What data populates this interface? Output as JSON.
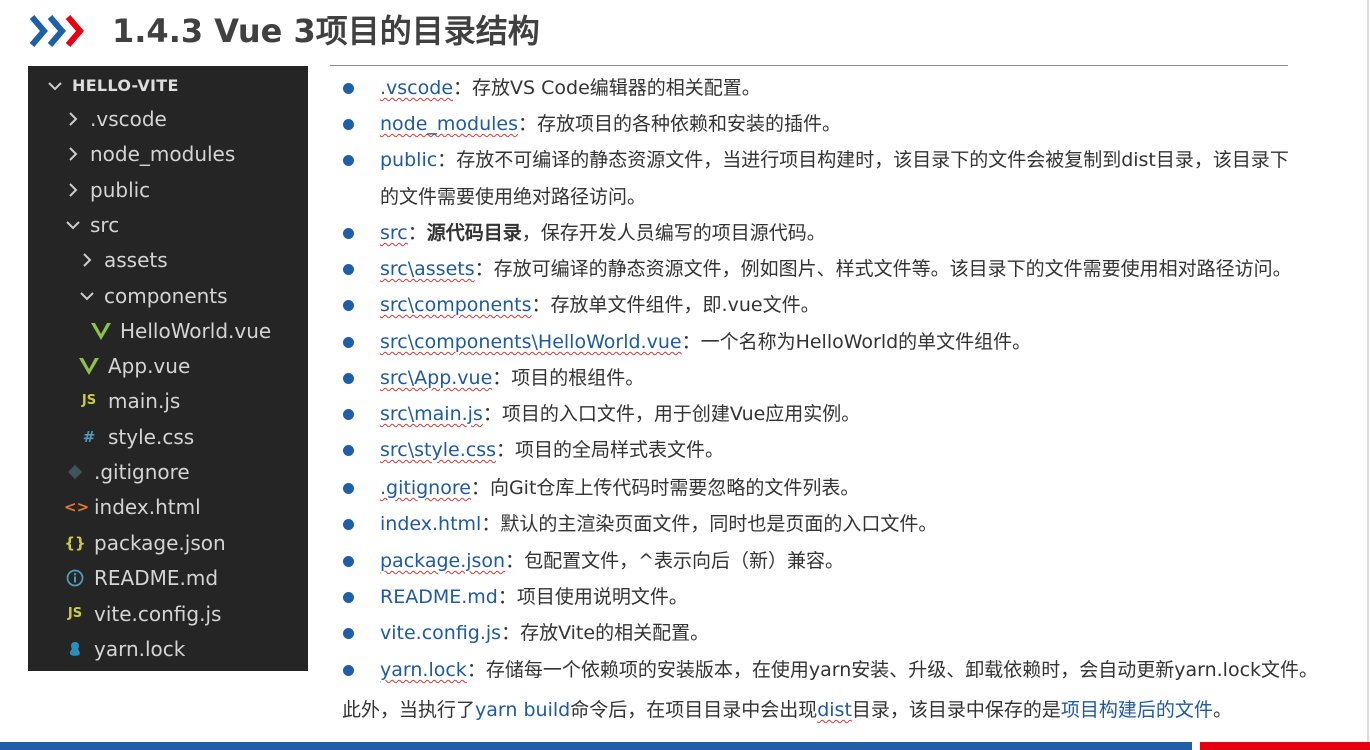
{
  "header": {
    "title": "1.4.3  Vue 3项目的目录结构"
  },
  "colors": {
    "accent_blue": "#1f5fa8",
    "accent_red": "#e60012",
    "explorer_bg": "#252526",
    "vue_green": "#8dc149",
    "js_yellow": "#cbcb41"
  },
  "explorer": {
    "root": "HELLO-VITE",
    "items": [
      {
        "label": ".vscode",
        "icon": "chevron-right-icon"
      },
      {
        "label": "node_modules",
        "icon": "chevron-right-icon"
      },
      {
        "label": "public",
        "icon": "chevron-right-icon"
      },
      {
        "label": "src",
        "icon": "chevron-down-icon"
      },
      {
        "label": "assets",
        "icon": "chevron-right-icon"
      },
      {
        "label": "components",
        "icon": "chevron-down-icon"
      },
      {
        "label": "HelloWorld.vue",
        "icon": "vue-icon"
      },
      {
        "label": "App.vue",
        "icon": "vue-icon"
      },
      {
        "label": "main.js",
        "icon": "js-icon",
        "icon_text": "JS"
      },
      {
        "label": "style.css",
        "icon": "css-icon",
        "icon_text": "#"
      },
      {
        "label": ".gitignore",
        "icon": "git-icon"
      },
      {
        "label": "index.html",
        "icon": "html-icon",
        "icon_text": "<>"
      },
      {
        "label": "package.json",
        "icon": "json-icon",
        "icon_text": "{}"
      },
      {
        "label": "README.md",
        "icon": "info-icon"
      },
      {
        "label": "vite.config.js",
        "icon": "js-icon",
        "icon_text": "JS"
      },
      {
        "label": "yarn.lock",
        "icon": "yarn-icon"
      }
    ]
  },
  "list": [
    {
      "name": ".vscode",
      "sep": "：",
      "desc": "存放VS Code编辑器的相关配置。"
    },
    {
      "name": "node_modules",
      "sep": "：",
      "desc": "存放项目的各种依赖和安装的插件。"
    },
    {
      "name": "public",
      "sep": "：",
      "desc": "存放不可编译的静态资源文件，当进行项目构建时，该目录下的文件会被复制到dist目录，该目录下",
      "cont": "的文件需要使用绝对路径访问。"
    },
    {
      "name": "src",
      "sep": "：",
      "bold": "源代码目录",
      "desc": "，保存开发人员编写的项目源代码。"
    },
    {
      "name": "src\\assets",
      "sep": "：",
      "desc": "存放可编译的静态资源文件，例如图片、样式文件等。该目录下的文件需要使用相对路径访问。"
    },
    {
      "name": "src\\components",
      "sep": "：",
      "desc": "存放单文件组件，即.vue文件。"
    },
    {
      "name": "src\\components\\HelloWorld.vue",
      "sep": "：",
      "desc": "一个名称为HelloWorld的单文件组件。"
    },
    {
      "name": "src\\App.vue",
      "sep": "：",
      "desc": "项目的根组件。"
    },
    {
      "name": "src\\main.js",
      "sep": "：",
      "desc": "项目的入口文件，用于创建Vue应用实例。"
    },
    {
      "name": "src\\style.css",
      "sep": "：",
      "desc": "项目的全局样式表文件。"
    },
    {
      "name": ".gitignore",
      "sep": "：",
      "desc": "向Git仓库上传代码时需要忽略的文件列表。"
    },
    {
      "name": "index.html",
      "sep": "：",
      "desc": "默认的主渲染页面文件，同时也是页面的入口文件。"
    },
    {
      "name": "package.json",
      "sep": "：",
      "desc": "包配置文件，^表示向后（新）兼容。"
    },
    {
      "name": "README.md",
      "sep": "：",
      "desc": "项目使用说明文件。"
    },
    {
      "name": "vite.config.js",
      "sep": "：",
      "desc": "存放Vite的相关配置。"
    },
    {
      "name": "yarn.lock",
      "sep": "：",
      "desc": "存储每一个依赖项的安装版本，在使用yarn安装、升级、卸载依赖时，会自动更新yarn.lock文件。"
    }
  ],
  "footer_note": {
    "pre": "此外，当执行了",
    "cmd": "yarn build",
    "mid": "命令后，在项目目录中会出现",
    "dir": "dist",
    "mid2": "目录，该目录中保存的是",
    "link": "项目构建后的文件",
    "end": "。"
  }
}
